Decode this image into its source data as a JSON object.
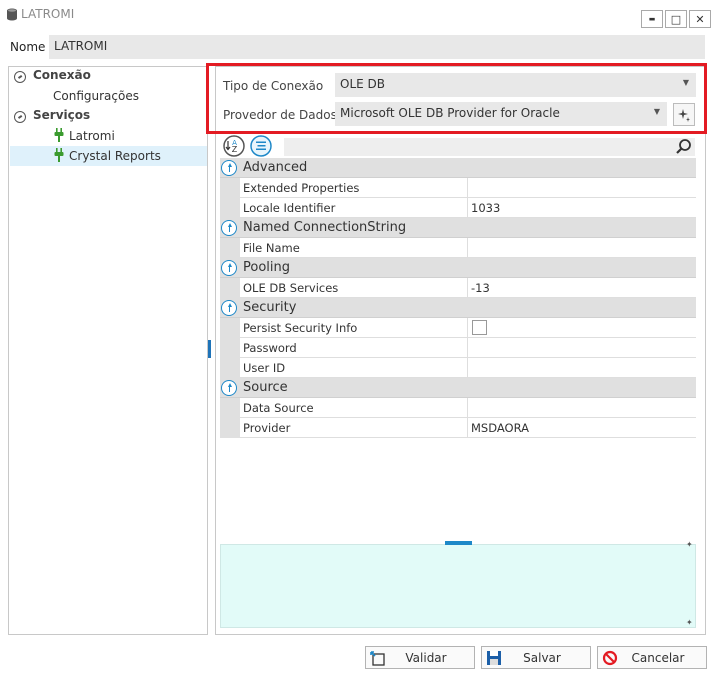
{
  "window": {
    "title": "LATROMI",
    "minimize": "▬",
    "maximize": "□",
    "close": "✕"
  },
  "nome": {
    "label": "Nome",
    "value": "LATROMI"
  },
  "tree": {
    "conexao": "Conexão",
    "configuracoes": "Configurações",
    "servicos": "Serviços",
    "latromi": "Latromi",
    "crystal": "Crystal Reports"
  },
  "connection": {
    "tipo_label": "Tipo de Conexão",
    "tipo_value": "OLE DB",
    "provedor_label": "Provedor de Dados",
    "provedor_value": "Microsoft OLE DB Provider for Oracle"
  },
  "grid": {
    "categories": {
      "advanced": "Advanced",
      "named": "Named ConnectionString",
      "pooling": "Pooling",
      "security": "Security",
      "source": "Source"
    },
    "props": {
      "extended_properties": {
        "name": "Extended Properties",
        "value": ""
      },
      "locale_identifier": {
        "name": "Locale Identifier",
        "value": "1033"
      },
      "file_name": {
        "name": "File Name",
        "value": ""
      },
      "ole_db_services": {
        "name": "OLE DB Services",
        "value": "-13"
      },
      "persist_security_info": {
        "name": "Persist Security Info",
        "value": ""
      },
      "password": {
        "name": "Password",
        "value": ""
      },
      "user_id": {
        "name": "User ID",
        "value": ""
      },
      "data_source": {
        "name": "Data Source",
        "value": ""
      },
      "provider": {
        "name": "Provider",
        "value": "MSDAORA"
      }
    }
  },
  "buttons": {
    "validar": "Validar",
    "salvar": "Salvar",
    "cancelar": "Cancelar"
  },
  "colors": {
    "accent": "#1e88c8",
    "highlight": "#e31b23",
    "plug": "#3b9b2f"
  }
}
